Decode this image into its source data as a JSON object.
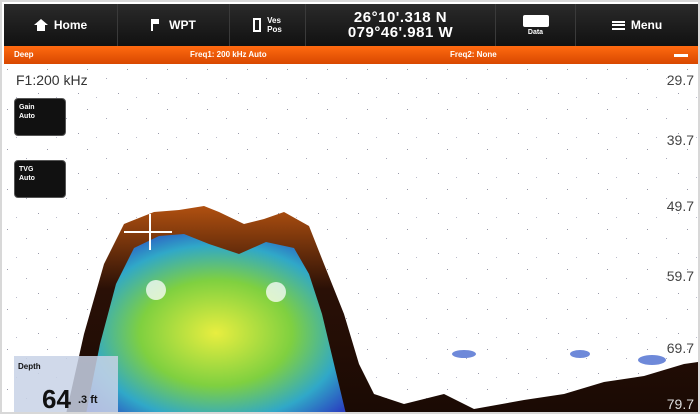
{
  "topbar": {
    "home_label": "Home",
    "wpt_label": "WPT",
    "vespos_line1": "Ves",
    "vespos_line2": "Pos",
    "latitude": "26°10'.318 N",
    "longitude": "079°46'.981 W",
    "data_label": "Data",
    "menu_label": "Menu"
  },
  "strip": {
    "mode": "Deep",
    "freq1": "Freq1: 200 kHz Auto",
    "freq2": "Freq2: None"
  },
  "sonar": {
    "frequency": "F1:200 kHz",
    "gain_button": [
      "Gain",
      "Auto"
    ],
    "tvg_button": [
      "TVG",
      "Auto"
    ],
    "depth_scale": [
      "29.7",
      "39.7",
      "49.7",
      "59.7",
      "69.7",
      "79.7"
    ],
    "depth_label": "Depth",
    "depth_value": "64",
    "depth_unit": ".3 ft"
  },
  "colors": {
    "topbar": "#111111",
    "strip": "#ff5a00",
    "bottom_edge": "#1a0c04",
    "echo_hot": "#e0e830",
    "echo_mid": "#40c050",
    "echo_low": "#3050d0"
  }
}
